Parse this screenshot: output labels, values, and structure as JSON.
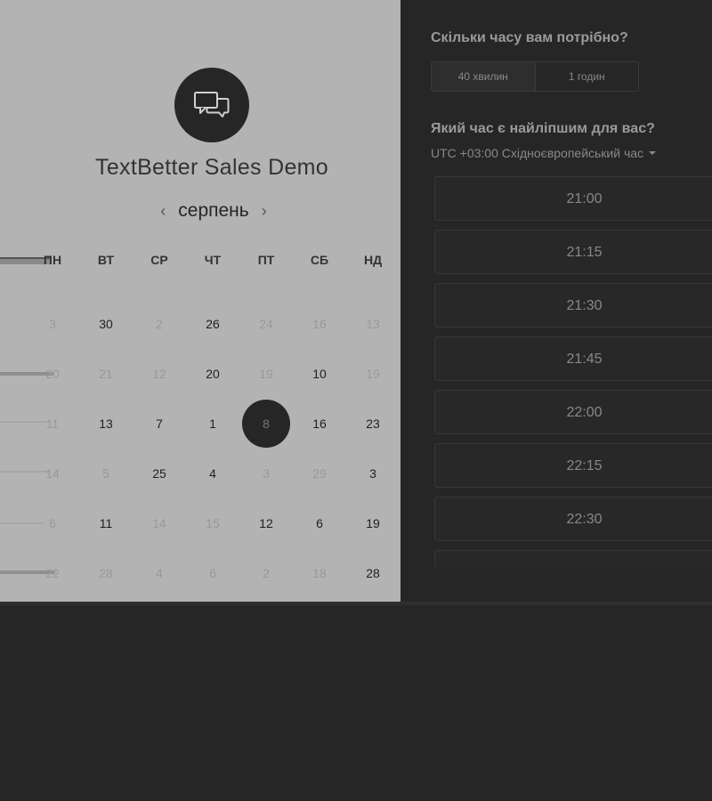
{
  "colors": {
    "panel_left": "#b3b3b3",
    "panel_right": "#262626",
    "selected_day": "#262626"
  },
  "event": {
    "title": "TextBetter Sales Demo",
    "avatar_icon": "chat-bubbles-icon"
  },
  "calendar": {
    "month": "серпень",
    "prev_icon": "chevron-left-icon",
    "next_icon": "chevron-right-icon",
    "weekdays": [
      "ПН",
      "ВТ",
      "СР",
      "ЧТ",
      "ПТ",
      "СБ",
      "НД"
    ],
    "weeks": [
      [
        "3",
        "30",
        "2",
        "26",
        "24",
        "16",
        "13"
      ],
      [
        "20",
        "21",
        "12",
        "20",
        "19",
        "10",
        "19"
      ],
      [
        "11",
        "13",
        "7",
        "1",
        "8",
        "16",
        "23"
      ],
      [
        "14",
        "5",
        "25",
        "4",
        "3",
        "29",
        "3"
      ],
      [
        "6",
        "11",
        "14",
        "15",
        "12",
        "6",
        "19"
      ],
      [
        "22",
        "28",
        "4",
        "6",
        "2",
        "18",
        "28"
      ]
    ],
    "selected": "8"
  },
  "scheduler": {
    "duration_question": "Скільки часу вам потрібно?",
    "durations": [
      "40 хвилин",
      "1 годин"
    ],
    "time_question": "Який час є найліпшим для вас?",
    "timezone": "UTC +03:00 Східноєвропейський час",
    "slots": [
      "21:00",
      "21:15",
      "21:30",
      "21:45",
      "22:00",
      "22:15",
      "22:30"
    ]
  }
}
